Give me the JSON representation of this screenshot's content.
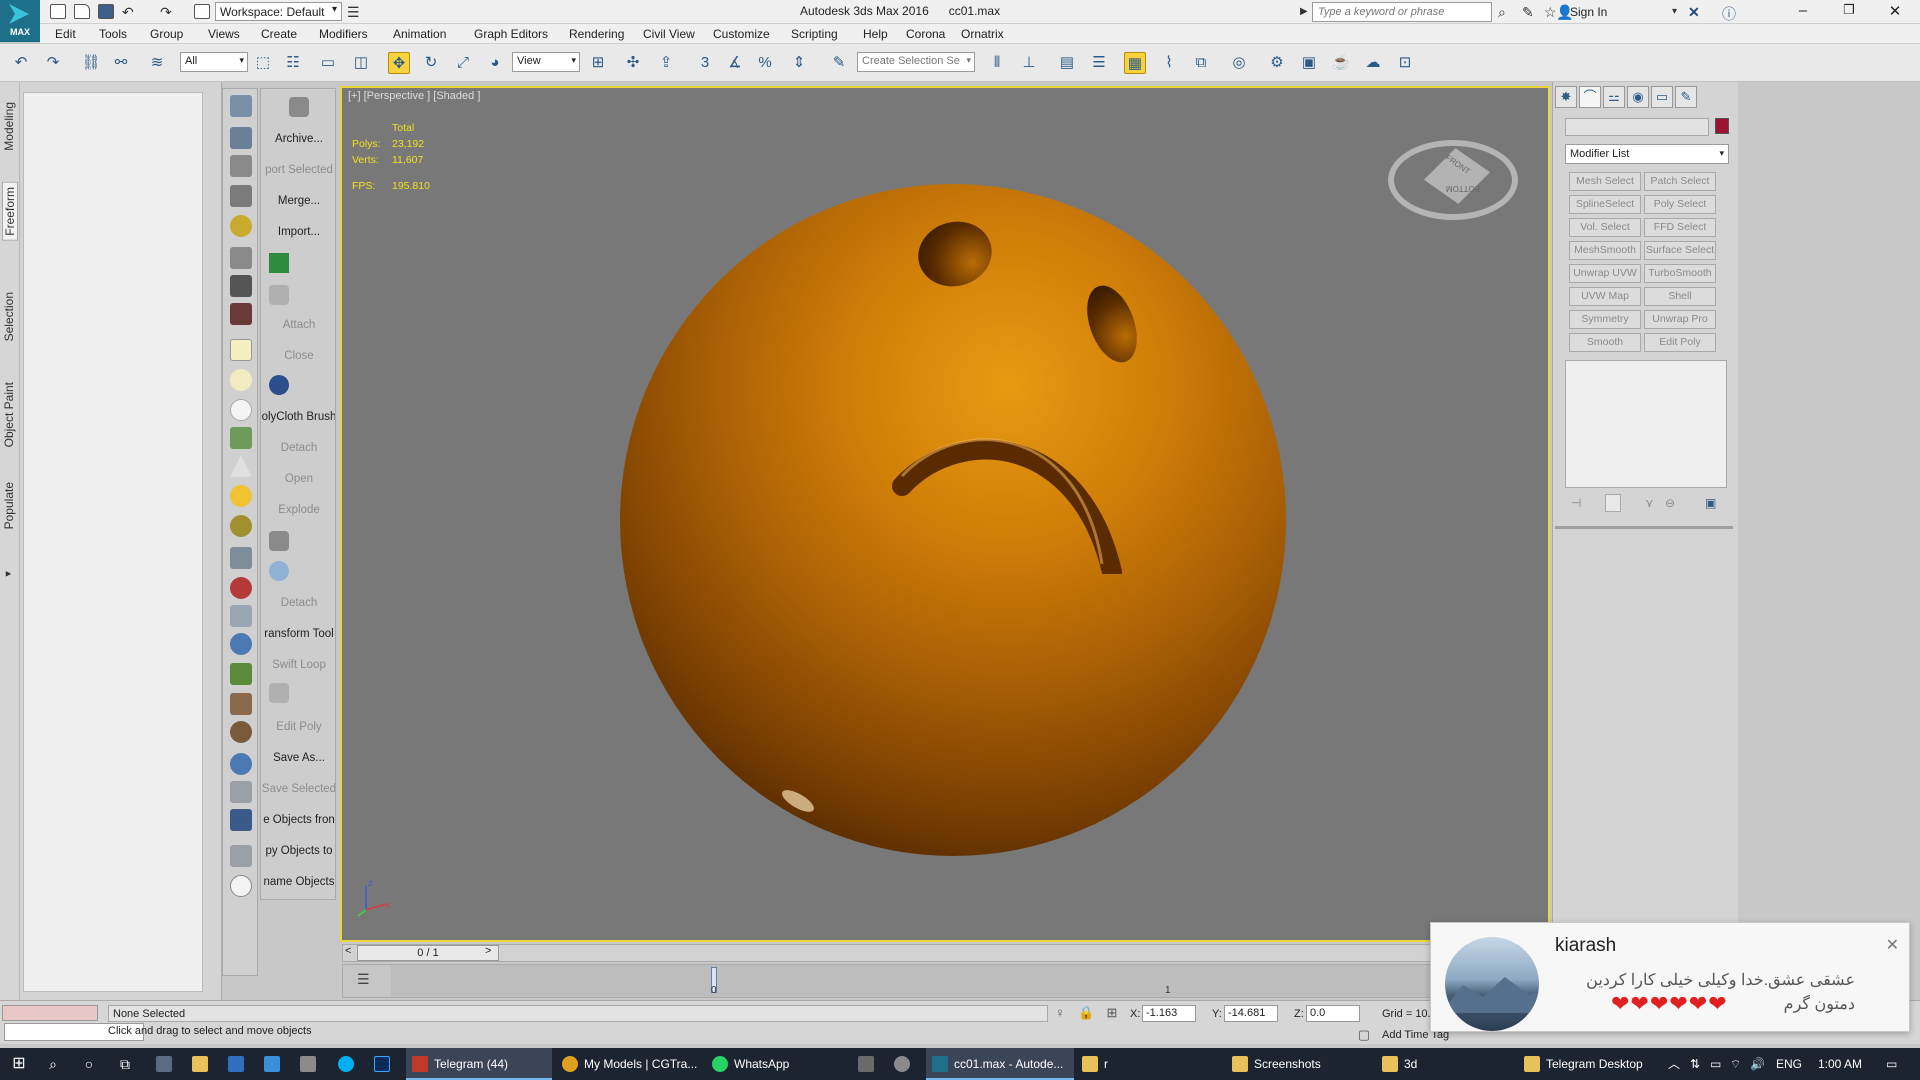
{
  "titlebar": {
    "logo_text": "MAX",
    "workspace": "Workspace: Default",
    "title": "Autodesk 3ds Max 2016      cc01.max",
    "search_placeholder": "Type a keyword or phrase",
    "sign_in": "Sign In"
  },
  "menu": [
    "Edit",
    "Tools",
    "Group",
    "Views",
    "Create",
    "Modifiers",
    "Animation",
    "Graph Editors",
    "Rendering",
    "Civil View",
    "Customize",
    "Scripting",
    "Help",
    "Corona",
    "Ornatrix"
  ],
  "toolbar": {
    "selection_filter": "All",
    "ref_coord": "View",
    "selection_set_placeholder": "Create Selection Se",
    "snap_label": "3"
  },
  "ribbon_tabs": [
    "Modeling",
    "Freeform",
    "Selection",
    "Object Paint",
    "Populate"
  ],
  "commands": [
    {
      "label": "Archive...",
      "disabled": false
    },
    {
      "label": "port Selected",
      "disabled": true
    },
    {
      "label": "Merge...",
      "disabled": false
    },
    {
      "label": "Import...",
      "disabled": false
    },
    {
      "label": "Attach",
      "disabled": true
    },
    {
      "label": "Close",
      "disabled": true
    },
    {
      "label": "olyCloth Brush",
      "disabled": false
    },
    {
      "label": "Detach",
      "disabled": true
    },
    {
      "label": "Open",
      "disabled": true
    },
    {
      "label": "Explode",
      "disabled": true
    },
    {
      "label": "Detach",
      "disabled": true
    },
    {
      "label": "ransform Tool",
      "disabled": false
    },
    {
      "label": "Swift Loop",
      "disabled": true
    },
    {
      "label": "Edit Poly",
      "disabled": true
    },
    {
      "label": "Save As...",
      "disabled": false
    },
    {
      "label": "Save Selected",
      "disabled": true
    },
    {
      "label": "e Objects fron",
      "disabled": false
    },
    {
      "label": "py Objects to",
      "disabled": false
    },
    {
      "label": "name Objects",
      "disabled": false
    }
  ],
  "viewport": {
    "label": "[+] [Perspective ] [Shaded ]",
    "stats_header": "Total",
    "polys_label": "Polys:",
    "polys_value": "23,192",
    "verts_label": "Verts:",
    "verts_value": "11,607",
    "fps_label": "FPS:",
    "fps_value": "195.810",
    "viewcube_top": "FRONT",
    "viewcube_side": "BOTTOM",
    "axis_z": "z",
    "axis_x": "x"
  },
  "command_panel": {
    "modifier_list": "Modifier List",
    "object_color": "#9b1233",
    "modifiers": [
      [
        "Mesh Select",
        "Patch Select"
      ],
      [
        "SplineSelect",
        "Poly Select"
      ],
      [
        "Vol. Select",
        "FFD Select"
      ],
      [
        "MeshSmooth",
        "Surface Select"
      ],
      [
        "Unwrap UVW",
        "TurboSmooth"
      ],
      [
        "UVW Map",
        "Shell"
      ],
      [
        "Symmetry",
        "Unwrap Pro"
      ],
      [
        "Smooth",
        "Edit Poly"
      ]
    ]
  },
  "timeline": {
    "frame": "0 / 1",
    "tick_0": "0",
    "tick_1": "1"
  },
  "status": {
    "selection": "None Selected",
    "prompt": "Click and drag to select and move objects",
    "x_label": "X:",
    "x_value": "-1.163",
    "y_label": "Y:",
    "y_value": "-14.681",
    "z_label": "Z:",
    "z_value": "0.0",
    "grid": "Grid = 10.",
    "add_time_tag": "Add Time Tag"
  },
  "toast": {
    "name": "kiarash",
    "message": "عشقی عشق.خدا وکیلی خیلی کارا کردین دمتون گرم",
    "hearts": "❤❤❤❤❤❤"
  },
  "taskbar": {
    "apps": [
      {
        "label": "Telegram (44)",
        "active": true,
        "color": "#c0392b"
      },
      {
        "label": "My Models | CGTra...",
        "active": false,
        "color": "#e0a020"
      },
      {
        "label": "WhatsApp",
        "active": false,
        "color": "#25d366"
      },
      {
        "label": "cc01.max - Autode...",
        "active": true,
        "color": "#1d6f8a"
      },
      {
        "label": "r",
        "active": false,
        "color": "#e8c15a"
      },
      {
        "label": "Screenshots",
        "active": false,
        "color": "#e8c15a"
      },
      {
        "label": "3d",
        "active": false,
        "color": "#e8c15a"
      },
      {
        "label": "Telegram Desktop",
        "active": false,
        "color": "#e8c15a"
      }
    ],
    "lang": "ENG",
    "time": "1:00 AM"
  }
}
